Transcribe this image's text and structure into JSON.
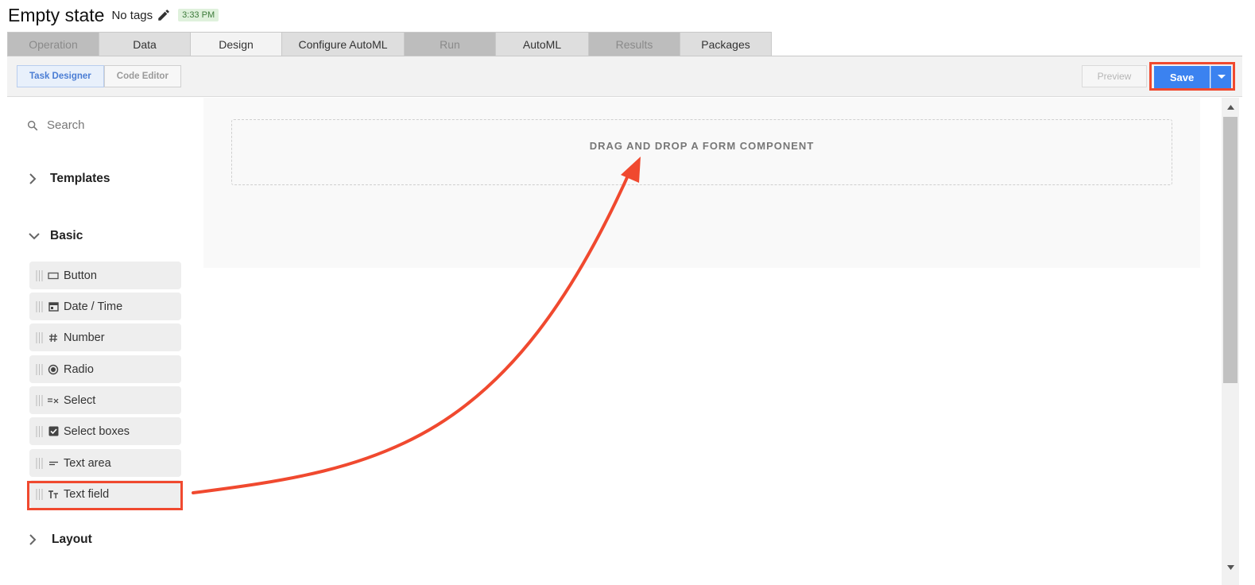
{
  "header": {
    "title": "Empty state",
    "tags_label": "No tags",
    "time": "3:33 PM"
  },
  "tabs": [
    {
      "label": "Operation",
      "state": "disabled"
    },
    {
      "label": "Data",
      "state": "normal"
    },
    {
      "label": "Design",
      "state": "active"
    },
    {
      "label": "Configure AutoML",
      "state": "normal"
    },
    {
      "label": "Run",
      "state": "disabled"
    },
    {
      "label": "AutoML",
      "state": "normal"
    },
    {
      "label": "Results",
      "state": "disabled"
    },
    {
      "label": "Packages",
      "state": "normal"
    }
  ],
  "toolbar": {
    "task_designer": "Task Designer",
    "code_editor": "Code Editor",
    "preview": "Preview",
    "save": "Save"
  },
  "sidebar": {
    "search_placeholder": "Search",
    "sections": {
      "templates": "Templates",
      "basic": "Basic",
      "layout": "Layout"
    },
    "components": [
      {
        "label": "Button",
        "icon": "button-icon"
      },
      {
        "label": "Date / Time",
        "icon": "calendar-icon"
      },
      {
        "label": "Number",
        "icon": "hash-icon"
      },
      {
        "label": "Radio",
        "icon": "radio-icon"
      },
      {
        "label": "Select",
        "icon": "select-list-icon"
      },
      {
        "label": "Select boxes",
        "icon": "checkbox-icon"
      },
      {
        "label": "Text area",
        "icon": "text-area-icon"
      },
      {
        "label": "Text field",
        "icon": "text-field-icon"
      }
    ]
  },
  "canvas": {
    "dropzone_text": "DRAG AND DROP A FORM COMPONENT"
  },
  "colors": {
    "accent": "#3b82f0",
    "annotation": "#f0492f",
    "time_badge_bg": "#dff1dc"
  }
}
